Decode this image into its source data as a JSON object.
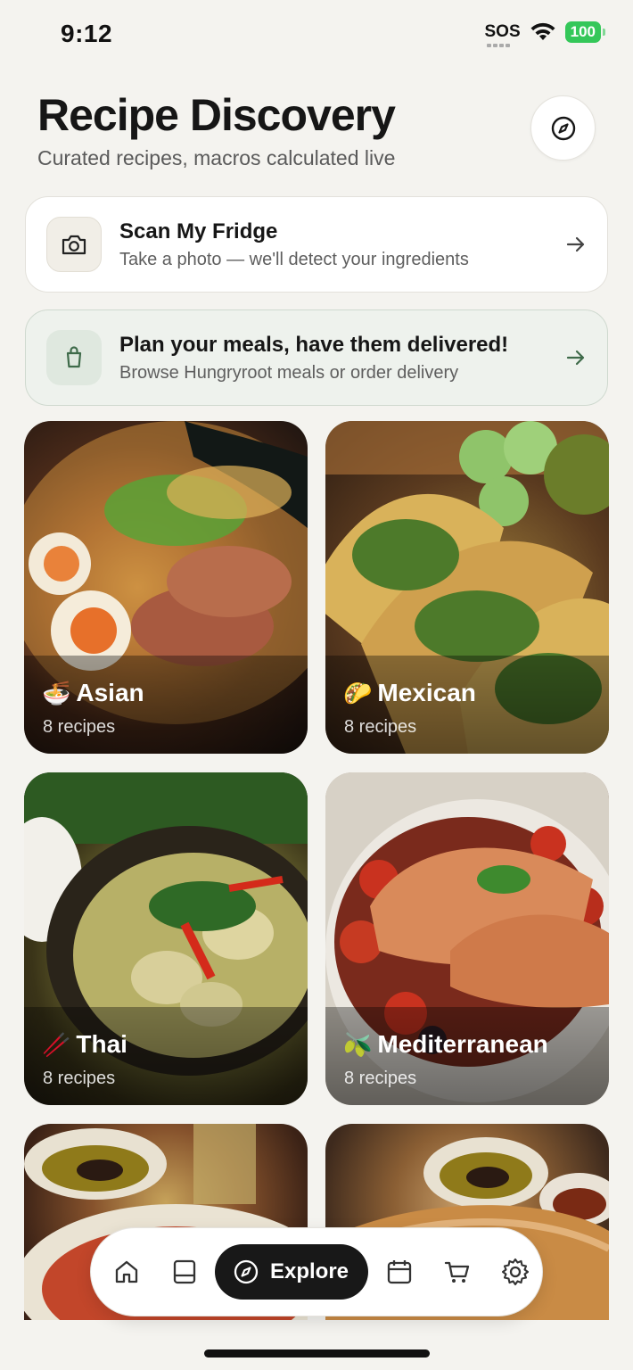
{
  "status_bar": {
    "time": "9:12",
    "sos": "SOS",
    "battery": "100"
  },
  "header": {
    "title": "Recipe Discovery",
    "subtitle": "Curated recipes, macros calculated live"
  },
  "scan_card": {
    "title": "Scan My Fridge",
    "subtitle": "Take a photo — we'll detect your ingredients"
  },
  "plan_card": {
    "title": "Plan your meals, have them delivered!",
    "subtitle": "Browse Hungryroot meals or order delivery"
  },
  "cuisines": [
    {
      "emoji": "🍜",
      "name": "Asian",
      "count": "8 recipes"
    },
    {
      "emoji": "🌮",
      "name": "Mexican",
      "count": "8 recipes"
    },
    {
      "emoji": "🥢",
      "name": "Thai",
      "count": "8 recipes"
    },
    {
      "emoji": "🫒",
      "name": "Mediterranean",
      "count": "8 recipes"
    }
  ],
  "bottom_nav": {
    "active_label": "Explore",
    "items": [
      "home-icon",
      "book-icon",
      "compass-icon",
      "calendar-icon",
      "cart-icon",
      "settings-icon"
    ]
  },
  "colors": {
    "background": "#f4f3ef",
    "plan_card_bg": "#eef2ed",
    "active_nav": "#181818",
    "battery": "#34c759"
  }
}
